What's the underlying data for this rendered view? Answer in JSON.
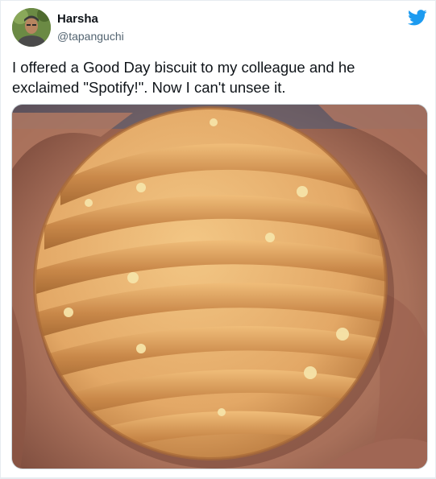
{
  "tweet": {
    "author_name": "Harsha",
    "author_handle": "@tapanguchi",
    "text": "I offered a Good Day biscuit to my colleague and he exclaimed \"Spotify!\". Now I can't unsee it.",
    "brand_icon": "twitter-bird-icon",
    "brand_color": "#1d9bf0",
    "media": {
      "subject": "biscuit-photo",
      "icon": "photo"
    }
  }
}
